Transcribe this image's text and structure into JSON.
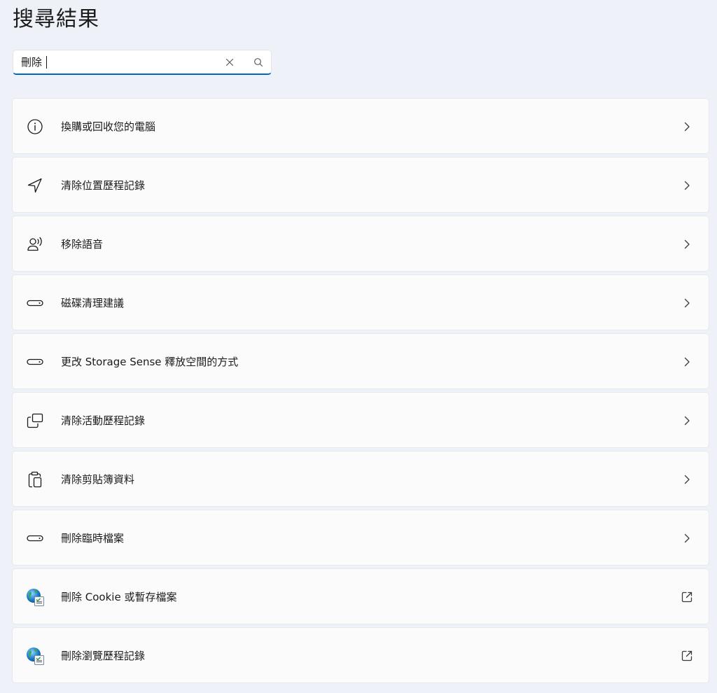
{
  "page": {
    "title": "搜尋結果"
  },
  "search": {
    "value": "刪除",
    "clear_icon": "close-icon",
    "search_icon": "search-icon",
    "accent_color": "#0067c0"
  },
  "results": [
    {
      "label": "換購或回收您的電腦",
      "icon": "info-icon",
      "action": "chevron-right-icon"
    },
    {
      "label": "清除位置歷程記錄",
      "icon": "location-arrow-icon",
      "action": "chevron-right-icon"
    },
    {
      "label": "移除語音",
      "icon": "speech-icon",
      "action": "chevron-right-icon"
    },
    {
      "label": "磁碟清理建議",
      "icon": "drive-icon",
      "action": "chevron-right-icon"
    },
    {
      "label": "更改 Storage Sense 釋放空間的方式",
      "icon": "drive-icon",
      "action": "chevron-right-icon"
    },
    {
      "label": "清除活動歷程記錄",
      "icon": "activity-history-icon",
      "action": "chevron-right-icon"
    },
    {
      "label": "清除剪貼簿資料",
      "icon": "clipboard-icon",
      "action": "chevron-right-icon"
    },
    {
      "label": "刪除臨時檔案",
      "icon": "drive-icon",
      "action": "chevron-right-icon"
    },
    {
      "label": "刪除 Cookie 或暫存檔案",
      "icon": "internet-options-icon",
      "action": "external-link-icon"
    },
    {
      "label": "刪除瀏覽歷程記錄",
      "icon": "internet-options-icon",
      "action": "external-link-icon"
    }
  ]
}
